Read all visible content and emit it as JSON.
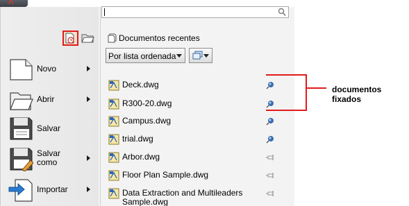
{
  "search": {
    "placeholder": ""
  },
  "commands": [
    {
      "id": "novo",
      "label": "Novo"
    },
    {
      "id": "abrir",
      "label": "Abrir"
    },
    {
      "id": "salvar",
      "label": "Salvar"
    },
    {
      "id": "salvar-como",
      "label": "Salvar\ncomo"
    },
    {
      "id": "importar",
      "label": "Importar"
    }
  ],
  "recent": {
    "title": "Documentos recentes",
    "sort_label": "Por lista ordenada",
    "files": [
      {
        "name": "Deck.dwg",
        "pinned": true
      },
      {
        "name": "R300-20.dwg",
        "pinned": true
      },
      {
        "name": "Campus.dwg",
        "pinned": true
      },
      {
        "name": "trial.dwg",
        "pinned": true
      },
      {
        "name": "Arbor.dwg",
        "pinned": false
      },
      {
        "name": "Floor Plan Sample.dwg",
        "pinned": false
      },
      {
        "name": "Data Extraction and Multileaders\nSample.dwg",
        "pinned": false
      }
    ]
  },
  "annotation": {
    "label": "documentos fixados"
  },
  "colors": {
    "highlight": "#e21a1a",
    "pin_pinned": "#3a6fb0",
    "pin_unpinned": "#9a9a9a"
  }
}
